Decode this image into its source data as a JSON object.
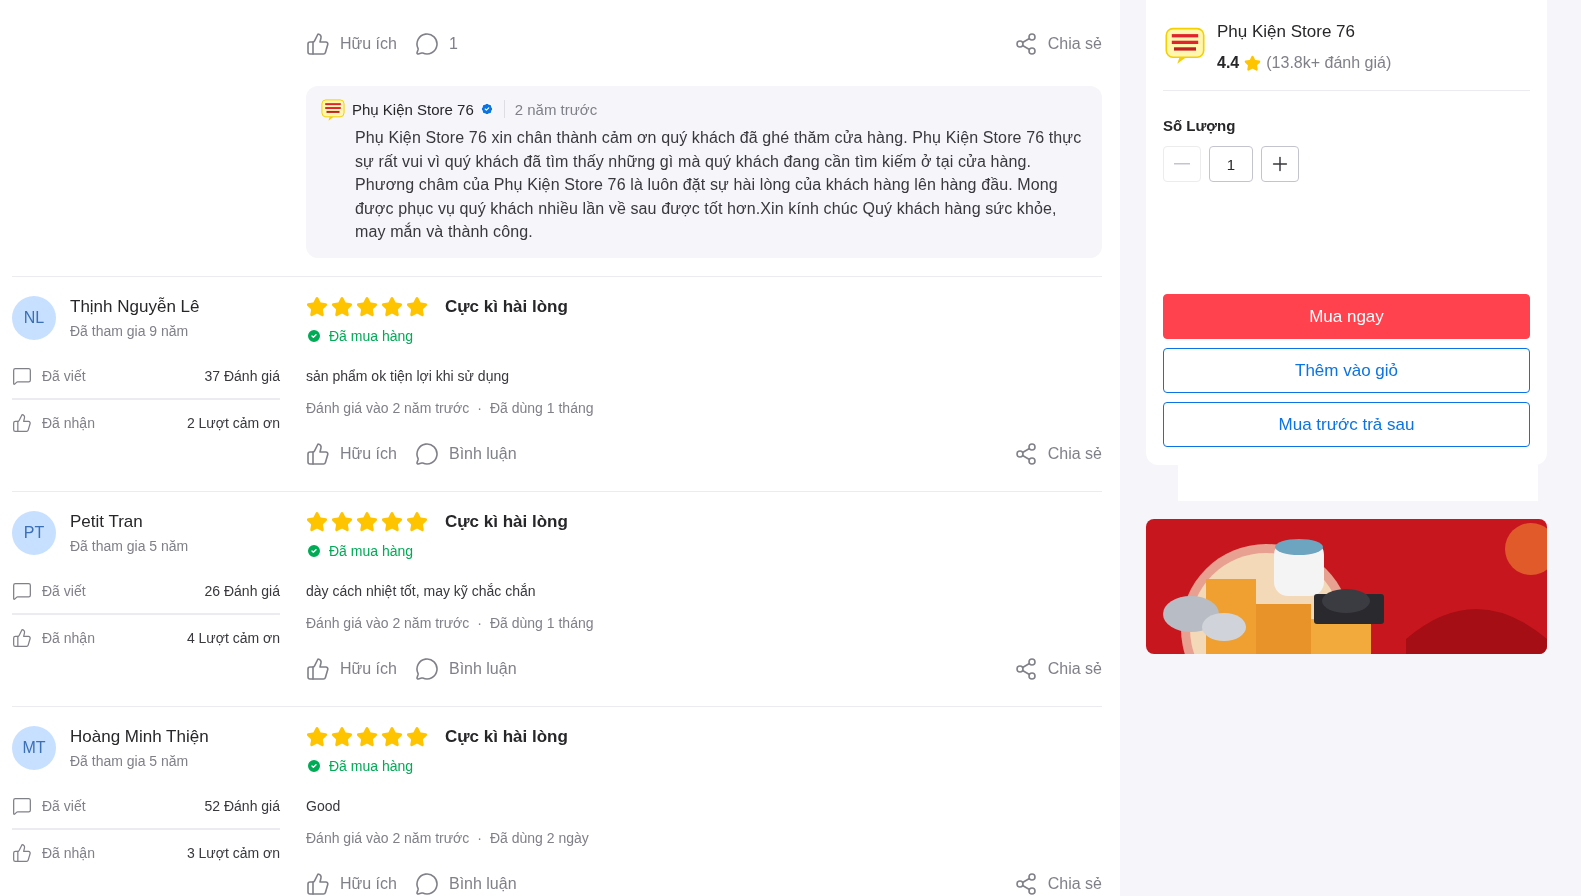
{
  "reviews": [
    {
      "actions": {
        "helpful": "Hữu ích",
        "comment": "1",
        "share": "Chia sẻ"
      },
      "reply": {
        "seller": "Phụ Kiện Store 76",
        "verified": true,
        "time": "2 năm trước",
        "text": "Phụ Kiện Store 76 xin chân thành cảm ơn quý khách đã ghé thăm cửa hàng. Phụ Kiện Store 76 thực sự rất vui vì quý khách đã tìm thấy những gì mà quý khách đang cần tìm kiếm ở tại cửa hàng. Phương châm của Phụ Kiện Store 76 là luôn đặt sự hài lòng của khách hàng lên hàng đầu. Mong được phục vụ quý khách nhiều lần về sau được tốt hơn.Xin kính chúc Quý khách hàng sức khỏe, may mắn và thành công."
      }
    },
    {
      "user": {
        "initials": "NL",
        "name": "Thịnh Nguyễn Lê",
        "joined": "Đã tham gia 9 năm",
        "stats": [
          {
            "kind": "written",
            "label": "Đã viết",
            "value": "37 Đánh giá"
          },
          {
            "kind": "received",
            "label": "Đã nhận",
            "value": "2 Lượt cảm ơn"
          }
        ]
      },
      "stars": 5,
      "rating_label": "Cực kì hài lòng",
      "purchased": "Đã mua hàng",
      "text": "sản phẩm ok tiện lợi khi sử dụng",
      "reviewed": "Đánh giá vào 2 năm trước",
      "separator": "·",
      "used": "Đã dùng 1 tháng",
      "actions": {
        "helpful": "Hữu ích",
        "comment": "Bình luận",
        "share": "Chia sẻ"
      }
    },
    {
      "user": {
        "initials": "PT",
        "name": "Petit Tran",
        "joined": "Đã tham gia 5 năm",
        "stats": [
          {
            "kind": "written",
            "label": "Đã viết",
            "value": "26 Đánh giá"
          },
          {
            "kind": "received",
            "label": "Đã nhận",
            "value": "4 Lượt cảm ơn"
          }
        ]
      },
      "stars": 5,
      "rating_label": "Cực kì hài lòng",
      "purchased": "Đã mua hàng",
      "text": "dày cách nhiệt tốt, may kỹ chắc chắn",
      "reviewed": "Đánh giá vào 2 năm trước",
      "separator": "·",
      "used": "Đã dùng 1 tháng",
      "actions": {
        "helpful": "Hữu ích",
        "comment": "Bình luận",
        "share": "Chia sẻ"
      }
    },
    {
      "user": {
        "initials": "MT",
        "name": "Hoàng Minh Thiện",
        "joined": "Đã tham gia 5 năm",
        "stats": [
          {
            "kind": "written",
            "label": "Đã viết",
            "value": "52 Đánh giá"
          },
          {
            "kind": "received",
            "label": "Đã nhận",
            "value": "3 Lượt cảm ơn"
          }
        ]
      },
      "stars": 5,
      "rating_label": "Cực kì hài lòng",
      "purchased": "Đã mua hàng",
      "text": "Good",
      "reviewed": "Đánh giá vào 2 năm trước",
      "separator": "·",
      "used": "Đã dùng 2 ngày",
      "actions": {
        "helpful": "Hữu ích",
        "comment": "Bình luận",
        "share": "Chia sẻ"
      }
    }
  ],
  "shop": {
    "name": "Phụ Kiện Store 76",
    "rating": "4.4",
    "review_count": "(13.8k+ đánh giá)"
  },
  "quantity": {
    "label": "Số Lượng",
    "value": "1",
    "minus_disabled": true
  },
  "buttons": [
    {
      "label": "Mua ngay",
      "kind": "primary"
    },
    {
      "label": "Thêm vào giỏ",
      "kind": "outline"
    },
    {
      "label": "Mua trước trả sau",
      "kind": "outline"
    }
  ]
}
